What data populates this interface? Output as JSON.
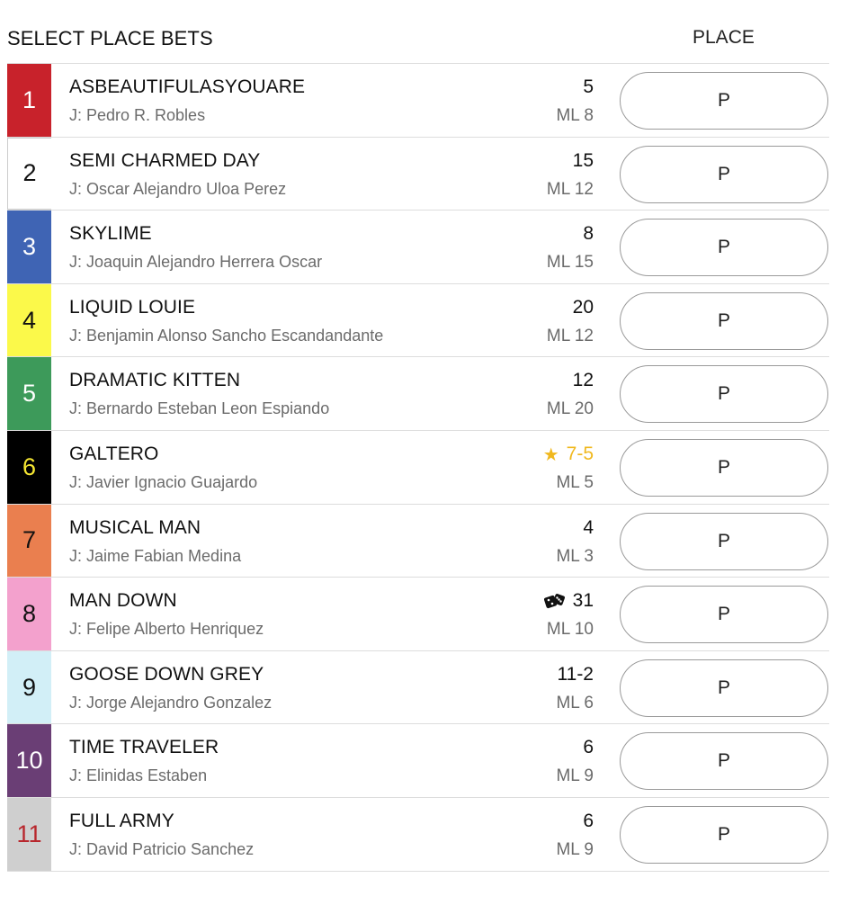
{
  "header": {
    "title": "SELECT PLACE BETS",
    "column_label": "PLACE"
  },
  "runners": [
    {
      "number": "1",
      "name": "ASBEAUTIFULASYOUARE",
      "jockey": "J: Pedro R. Robles",
      "odds": "5",
      "ml": "ML 8",
      "bet_label": "P",
      "bg": "#c8222b",
      "fg": "#ffffff"
    },
    {
      "number": "2",
      "name": "SEMI CHARMED DAY",
      "jockey": "J: Oscar Alejandro Uloa Perez",
      "odds": "15",
      "ml": "ML 12",
      "bet_label": "P",
      "bg": "#ffffff",
      "fg": "#111111"
    },
    {
      "number": "3",
      "name": "SKYLIME",
      "jockey": "J: Joaquin Alejandro Herrera Oscar",
      "odds": "8",
      "ml": "ML 15",
      "bet_label": "P",
      "bg": "#3f64b4",
      "fg": "#ffffff"
    },
    {
      "number": "4",
      "name": "LIQUID LOUIE",
      "jockey": "J: Benjamin Alonso Sancho Escandandante",
      "odds": "20",
      "ml": "ML 12",
      "bet_label": "P",
      "bg": "#fbf94a",
      "fg": "#111111"
    },
    {
      "number": "5",
      "name": "DRAMATIC KITTEN",
      "jockey": "J: Bernardo Esteban Leon Espiando",
      "odds": "12",
      "ml": "ML 20",
      "bet_label": "P",
      "bg": "#3d9a5a",
      "fg": "#ffffff"
    },
    {
      "number": "6",
      "name": "GALTERO",
      "jockey": "J: Javier Ignacio Guajardo",
      "odds": "7-5",
      "ml": "ML 5",
      "bet_label": "P",
      "bg": "#000000",
      "fg": "#f5e632",
      "odds_icon": "star-icon"
    },
    {
      "number": "7",
      "name": "MUSICAL MAN",
      "jockey": "J: Jaime Fabian Medina",
      "odds": "4",
      "ml": "ML 3",
      "bet_label": "P",
      "bg": "#ea7f4f",
      "fg": "#111111"
    },
    {
      "number": "8",
      "name": "MAN DOWN",
      "jockey": "J: Felipe Alberto Henriquez",
      "odds": "31",
      "ml": "ML 10",
      "bet_label": "P",
      "bg": "#f3a1cd",
      "fg": "#111111",
      "odds_icon": "dice-icon"
    },
    {
      "number": "9",
      "name": "GOOSE DOWN GREY",
      "jockey": "J: Jorge Alejandro Gonzalez",
      "odds": "11-2",
      "ml": "ML 6",
      "bet_label": "P",
      "bg": "#d2eff7",
      "fg": "#111111"
    },
    {
      "number": "10",
      "name": "TIME TRAVELER",
      "jockey": "J: Elinidas Estaben",
      "odds": "6",
      "ml": "ML 9",
      "bet_label": "P",
      "bg": "#6a3e75",
      "fg": "#ffffff"
    },
    {
      "number": "11",
      "name": "FULL ARMY",
      "jockey": "J: David Patricio Sanchez",
      "odds": "6",
      "ml": "ML 9",
      "bet_label": "P",
      "bg": "#cfcfcf",
      "fg": "#b8272d"
    }
  ]
}
